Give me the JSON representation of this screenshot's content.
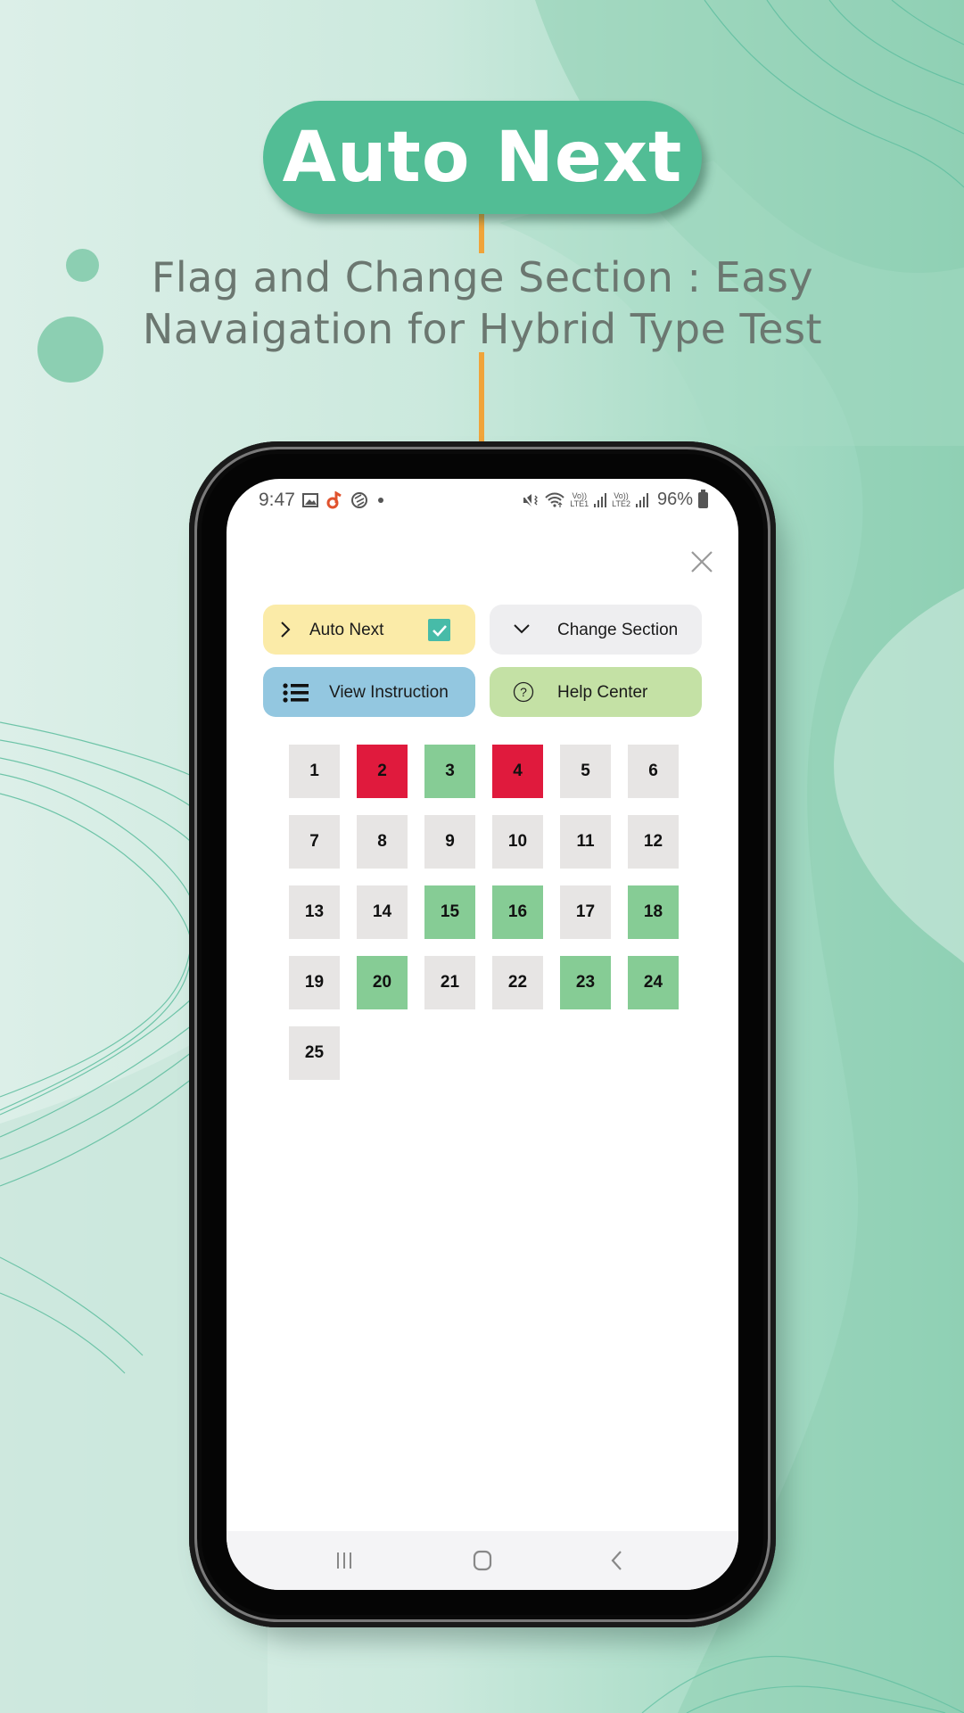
{
  "promo": {
    "title": "Auto Next",
    "subtitle_line1": "Flag and Change Section : Easy",
    "subtitle_line2": "Navaigation for Hybrid Type Test"
  },
  "colors": {
    "accent": "#52bd95",
    "connector": "#f0a43a",
    "answered": "#86cc95",
    "flagged": "#e01a3d",
    "unvisited": "#e7e5e4",
    "auto_next_bg": "#fbeba8",
    "change_section_bg": "#eeeef0",
    "view_instruction_bg": "#93c7e0",
    "help_center_bg": "#c4e1a5",
    "checkbox": "#47bba8"
  },
  "statusbar": {
    "time": "9:47",
    "left_icons": [
      "gallery-icon",
      "music-app-icon",
      "sync-icon",
      "dot-icon"
    ],
    "right_icons": [
      "mute-vibrate-icon",
      "wifi-icon",
      "volte-lte1-signal-icon",
      "volte-lte2-signal-icon",
      "battery-icon"
    ],
    "lte1": "LTE1",
    "lte2": "LTE2",
    "volte": "Vo))",
    "battery": "96%"
  },
  "actions": {
    "auto_next": {
      "label": "Auto Next",
      "icon": "chevron-right-icon",
      "checked": true
    },
    "change_section": {
      "label": "Change Section",
      "icon": "chevron-down-icon"
    },
    "view_instruction": {
      "label": "View Instruction",
      "icon": "list-icon"
    },
    "help_center": {
      "label": "Help Center",
      "icon": "help-circle-icon"
    }
  },
  "questions": [
    {
      "n": "1",
      "status": "unvisited"
    },
    {
      "n": "2",
      "status": "flagged"
    },
    {
      "n": "3",
      "status": "answered"
    },
    {
      "n": "4",
      "status": "flagged"
    },
    {
      "n": "5",
      "status": "unvisited"
    },
    {
      "n": "6",
      "status": "unvisited"
    },
    {
      "n": "7",
      "status": "unvisited"
    },
    {
      "n": "8",
      "status": "unvisited"
    },
    {
      "n": "9",
      "status": "unvisited"
    },
    {
      "n": "10",
      "status": "unvisited"
    },
    {
      "n": "11",
      "status": "unvisited"
    },
    {
      "n": "12",
      "status": "unvisited"
    },
    {
      "n": "13",
      "status": "unvisited"
    },
    {
      "n": "14",
      "status": "unvisited"
    },
    {
      "n": "15",
      "status": "answered"
    },
    {
      "n": "16",
      "status": "answered"
    },
    {
      "n": "17",
      "status": "unvisited"
    },
    {
      "n": "18",
      "status": "answered"
    },
    {
      "n": "19",
      "status": "unvisited"
    },
    {
      "n": "20",
      "status": "answered"
    },
    {
      "n": "21",
      "status": "unvisited"
    },
    {
      "n": "22",
      "status": "unvisited"
    },
    {
      "n": "23",
      "status": "answered"
    },
    {
      "n": "24",
      "status": "answered"
    },
    {
      "n": "25",
      "status": "unvisited"
    }
  ],
  "navbar": {
    "items": [
      "recents-icon",
      "home-icon",
      "back-icon"
    ]
  }
}
